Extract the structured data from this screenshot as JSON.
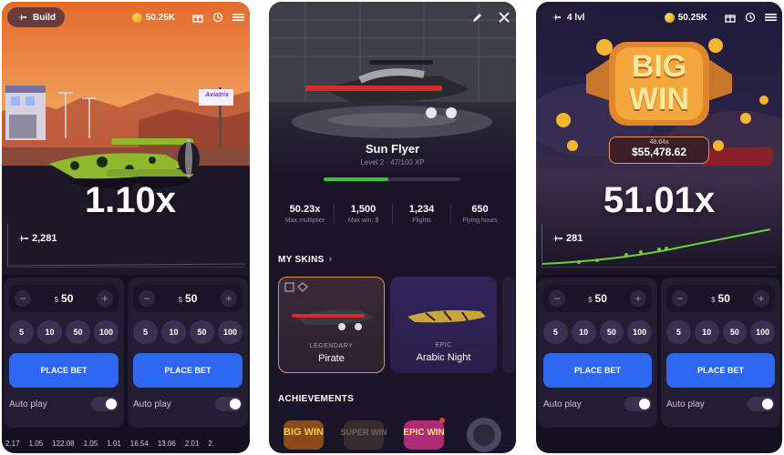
{
  "left_panel": {
    "pill_label": "Build",
    "balance": "50.25K",
    "multiplier": "1.10x",
    "players": "2,281",
    "sign_text": "Aviatrix",
    "bets": [
      {
        "currency": "$",
        "amount": "50",
        "chips": [
          "5",
          "10",
          "50",
          "100"
        ],
        "place_bet": "PLACE BET",
        "auto_play": "Auto play"
      },
      {
        "currency": "$",
        "amount": "50",
        "chips": [
          "5",
          "10",
          "50",
          "100"
        ],
        "place_bet": "PLACE BET",
        "auto_play": "Auto play"
      }
    ],
    "history": [
      "2.17",
      "1.05",
      "122.08",
      "1.05",
      "1.01",
      "16.54",
      "13.06",
      "2.01",
      "2."
    ]
  },
  "middle_panel": {
    "plane_name": "Sun Flyer",
    "level_text": "Level 2 · 47/100 XP",
    "xp_progress": 0.47,
    "stats": [
      {
        "value": "50.23x",
        "label": "Max multiplier"
      },
      {
        "value": "1,500",
        "label": "Max win, $"
      },
      {
        "value": "1,234",
        "label": "Flights"
      },
      {
        "value": "650",
        "label": "Flying hours"
      }
    ],
    "skins_title": "MY SKINS",
    "skins": [
      {
        "rarity": "LEGENDARY",
        "name": "Pirate"
      },
      {
        "rarity": "EPIC",
        "name": "Arabic Night"
      }
    ],
    "achievements_title": "ACHIEVEMENTS",
    "badges": [
      "BIG WIN",
      "SUPER WIN",
      "EPIC WIN",
      ""
    ]
  },
  "right_panel": {
    "pill_label": "4 lvl",
    "balance": "50.25K",
    "big_win_line1": "BIG",
    "big_win_line2": "WIN",
    "win_multiplier": "48.64x",
    "win_amount": "$55,478.62",
    "multiplier": "51.01x",
    "players": "281",
    "bets": [
      {
        "currency": "$",
        "amount": "50",
        "chips": [
          "5",
          "10",
          "50",
          "100"
        ],
        "place_bet": "PLACE BET",
        "auto_play": "Auto play"
      },
      {
        "currency": "$",
        "amount": "50",
        "chips": [
          "5",
          "10",
          "50",
          "100"
        ],
        "place_bet": "PLACE BET",
        "auto_play": "Auto play"
      }
    ]
  },
  "colors": {
    "accent_blue": "#2f68f0",
    "xp_green": "#3fbf3c",
    "gold": "#f2b632",
    "selected_border": "#e7904a"
  }
}
